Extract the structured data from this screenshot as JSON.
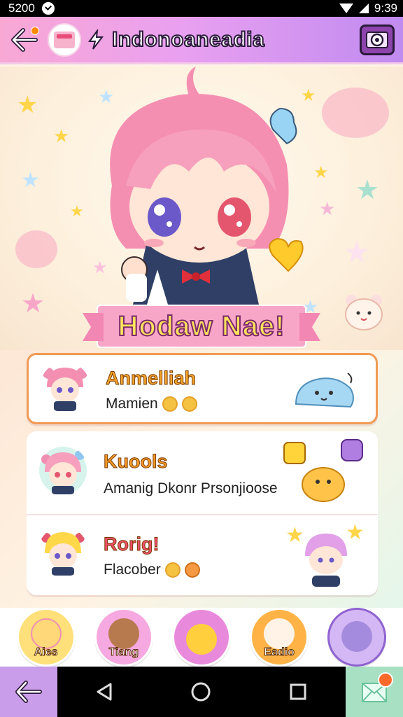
{
  "status_bar": {
    "time_left": "5200",
    "time_right": "9:39"
  },
  "header": {
    "title": "Indonoaneadia"
  },
  "hero": {
    "banner": "Hodaw Nae!"
  },
  "list": [
    {
      "name": "Anmelliah",
      "subtitle": "Mamien",
      "name_color": "#f3a52c"
    },
    {
      "name": "Kuools",
      "subtitle": "Amanig Dkonr Prsonjioose",
      "name_color": "#f59a2a"
    },
    {
      "name": "Rorig!",
      "subtitle": "Flacober",
      "name_color": "#ef4f6a"
    }
  ],
  "bottom_icons": [
    {
      "label": "Aies",
      "bg": "#ffe07a",
      "face": "#ffd87a"
    },
    {
      "label": "Tiang",
      "bg": "#f6a8e0",
      "face": "#b77a4e"
    },
    {
      "label": "",
      "bg": "#e989dc",
      "face": "#ffcf3d"
    },
    {
      "label": "Eadio",
      "bg": "#ffb347",
      "face": "#fff2e6"
    },
    {
      "label": "",
      "bg": "#d4b8f5",
      "face": "#a58bdd"
    }
  ],
  "icons": {
    "back": "back-arrow-icon",
    "camera": "camera-icon",
    "nav_back": "triangle-back-icon",
    "nav_home": "circle-home-icon",
    "nav_recent": "square-recent-icon"
  }
}
